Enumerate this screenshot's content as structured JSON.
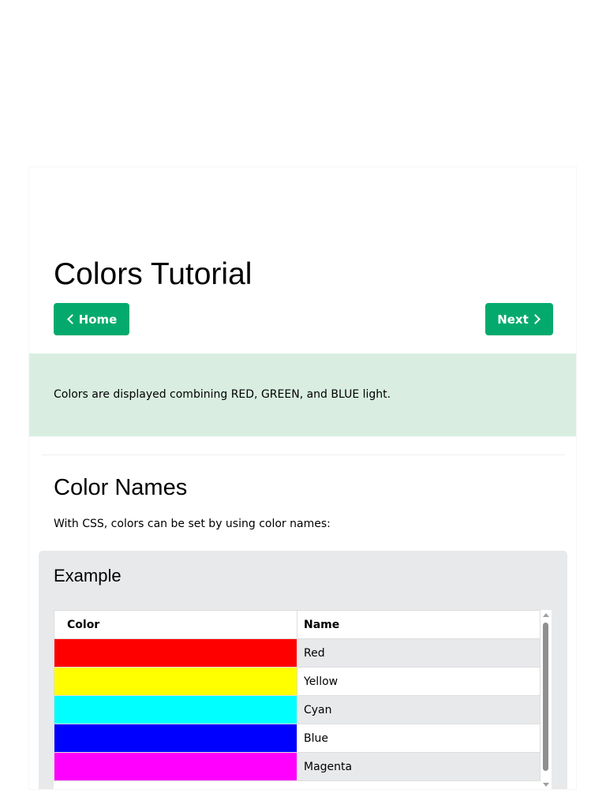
{
  "page": {
    "title": "Colors Tutorial",
    "home_label": "Home",
    "next_label": "Next",
    "intro": "Colors are displayed combining RED, GREEN, and BLUE light."
  },
  "section": {
    "title": "Color Names",
    "text": "With CSS, colors can be set by using color names:"
  },
  "example": {
    "title": "Example",
    "headers": {
      "color": "Color",
      "name": "Name"
    },
    "rows": [
      {
        "swatch": "#ff0000",
        "name": "Red"
      },
      {
        "swatch": "#ffff00",
        "name": "Yellow"
      },
      {
        "swatch": "#00ffff",
        "name": "Cyan"
      },
      {
        "swatch": "#0000ff",
        "name": "Blue"
      },
      {
        "swatch": "#ff00ff",
        "name": "Magenta"
      }
    ]
  },
  "colors": {
    "button": "#04aa6d",
    "intro_panel": "#d9eee1",
    "example_box": "#e7e9eb"
  },
  "icons": {
    "home_icon": "chevron-left-icon",
    "next_icon": "chevron-right-icon"
  }
}
